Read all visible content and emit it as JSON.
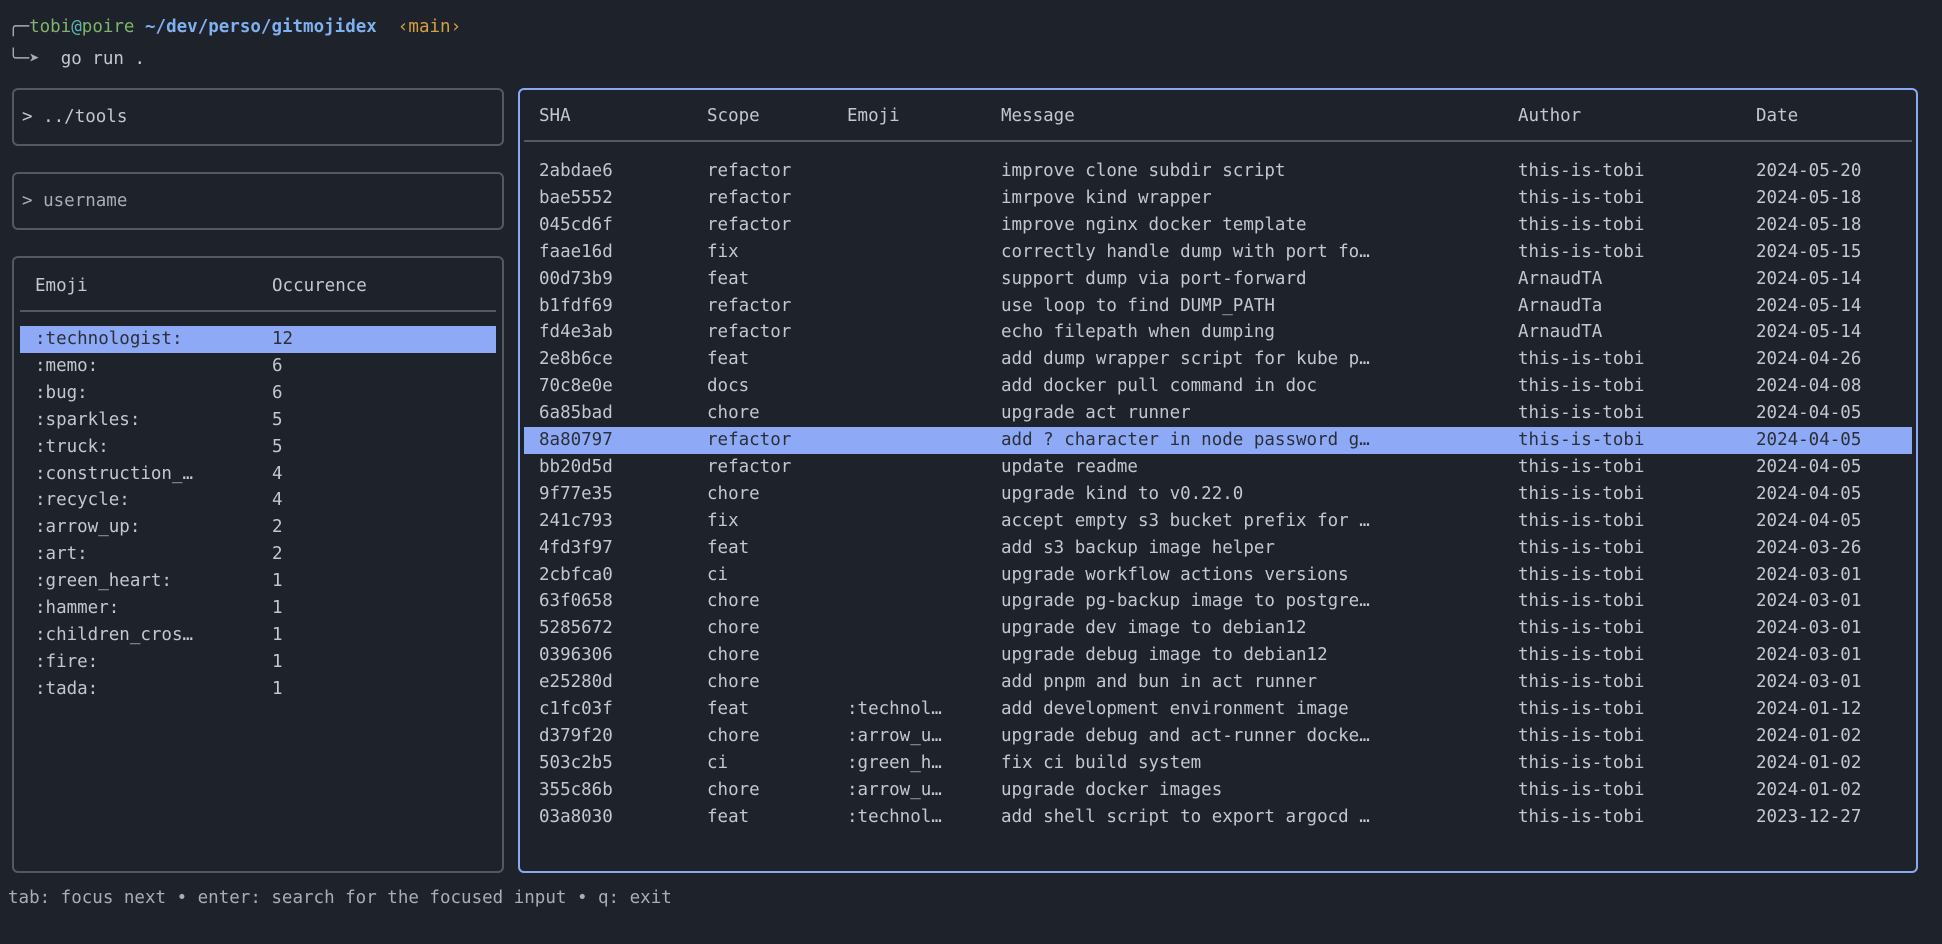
{
  "prompt": {
    "user": "tobi",
    "at": "@",
    "host": "poire",
    "path": "~/dev/perso/gitmojidex",
    "branch": "‹main›",
    "arrow": "╰─➤",
    "corner": "╭─",
    "command": "go run ."
  },
  "inputs": {
    "path_value": "../tools",
    "username_placeholder": "username",
    "prompt_char": ">"
  },
  "emoji_table": {
    "headers": [
      "Emoji",
      "Occurence"
    ],
    "selected_index": 0,
    "rows": [
      [
        ":technologist:",
        "12"
      ],
      [
        ":memo:",
        "6"
      ],
      [
        ":bug:",
        "6"
      ],
      [
        ":sparkles:",
        "5"
      ],
      [
        ":truck:",
        "5"
      ],
      [
        ":construction_…",
        "4"
      ],
      [
        ":recycle:",
        "4"
      ],
      [
        ":arrow_up:",
        "2"
      ],
      [
        ":art:",
        "2"
      ],
      [
        ":green_heart:",
        "1"
      ],
      [
        ":hammer:",
        "1"
      ],
      [
        ":children_cros…",
        "1"
      ],
      [
        ":fire:",
        "1"
      ],
      [
        ":tada:",
        "1"
      ]
    ]
  },
  "commits_table": {
    "headers": [
      "SHA",
      "Scope",
      "Emoji",
      "Message",
      "Author",
      "Date"
    ],
    "selected_index": 10,
    "rows": [
      [
        "2abdae6",
        "refactor",
        "",
        "improve clone subdir script",
        "this-is-tobi",
        "2024-05-20"
      ],
      [
        "bae5552",
        "refactor",
        "",
        "imrpove kind wrapper",
        "this-is-tobi",
        "2024-05-18"
      ],
      [
        "045cd6f",
        "refactor",
        "",
        "improve nginx docker template",
        "this-is-tobi",
        "2024-05-18"
      ],
      [
        "faae16d",
        "fix",
        "",
        "correctly handle dump with port fo…",
        "this-is-tobi",
        "2024-05-15"
      ],
      [
        "00d73b9",
        "feat",
        "",
        "support dump via port-forward",
        "ArnaudTA",
        "2024-05-14"
      ],
      [
        "b1fdf69",
        "refactor",
        "",
        "use loop to find DUMP_PATH",
        "ArnaudTa",
        "2024-05-14"
      ],
      [
        "fd4e3ab",
        "refactor",
        "",
        "echo filepath when dumping",
        "ArnaudTA",
        "2024-05-14"
      ],
      [
        "2e8b6ce",
        "feat",
        "",
        "add dump wrapper script for kube p…",
        "this-is-tobi",
        "2024-04-26"
      ],
      [
        "70c8e0e",
        "docs",
        "",
        "add docker pull command in doc",
        "this-is-tobi",
        "2024-04-08"
      ],
      [
        "6a85bad",
        "chore",
        "",
        "upgrade act runner",
        "this-is-tobi",
        "2024-04-05"
      ],
      [
        "8a80797",
        "refactor",
        "",
        "add ? character in node password g…",
        "this-is-tobi",
        "2024-04-05"
      ],
      [
        "bb20d5d",
        "refactor",
        "",
        "update readme",
        "this-is-tobi",
        "2024-04-05"
      ],
      [
        "9f77e35",
        "chore",
        "",
        "upgrade kind to v0.22.0",
        "this-is-tobi",
        "2024-04-05"
      ],
      [
        "241c793",
        "fix",
        "",
        "accept empty s3 bucket prefix for …",
        "this-is-tobi",
        "2024-04-05"
      ],
      [
        "4fd3f97",
        "feat",
        "",
        "add s3 backup image helper",
        "this-is-tobi",
        "2024-03-26"
      ],
      [
        "2cbfca0",
        "ci",
        "",
        "upgrade workflow actions versions",
        "this-is-tobi",
        "2024-03-01"
      ],
      [
        "63f0658",
        "chore",
        "",
        "upgrade pg-backup image to postgre…",
        "this-is-tobi",
        "2024-03-01"
      ],
      [
        "5285672",
        "chore",
        "",
        "upgrade dev image to debian12",
        "this-is-tobi",
        "2024-03-01"
      ],
      [
        "0396306",
        "chore",
        "",
        "upgrade debug image to debian12",
        "this-is-tobi",
        "2024-03-01"
      ],
      [
        "e25280d",
        "chore",
        "",
        "add pnpm and bun in act runner",
        "this-is-tobi",
        "2024-03-01"
      ],
      [
        "c1fc03f",
        "feat",
        ":technol…",
        "add development environment image",
        "this-is-tobi",
        "2024-01-12"
      ],
      [
        "d379f20",
        "chore",
        ":arrow_u…",
        "upgrade debug and act-runner docke…",
        "this-is-tobi",
        "2024-01-02"
      ],
      [
        "503c2b5",
        "ci",
        ":green_h…",
        "fix ci build system",
        "this-is-tobi",
        "2024-01-02"
      ],
      [
        "355c86b",
        "chore",
        ":arrow_u…",
        "upgrade docker images",
        "this-is-tobi",
        "2024-01-02"
      ],
      [
        "03a8030",
        "feat",
        ":technol…",
        "add shell script to export argocd …",
        "this-is-tobi",
        "2023-12-27"
      ]
    ]
  },
  "footer": {
    "help": "tab: focus next • enter: search for the focused input • q: exit"
  },
  "colors": {
    "background": "#1e222a",
    "selection": "#8eaaf7",
    "focus_border": "#8aa9f2",
    "border": "#535962"
  }
}
